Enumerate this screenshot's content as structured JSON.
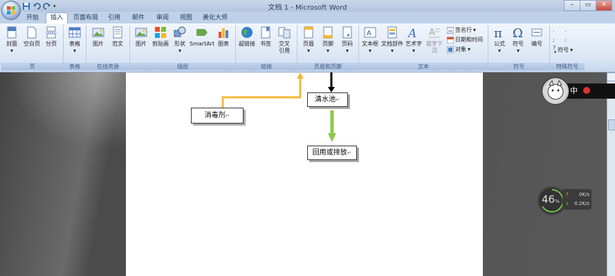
{
  "window": {
    "title": "文档 1 - Microsoft Word"
  },
  "quick_access": [
    "save-icon",
    "undo-icon",
    "redo-icon"
  ],
  "tabs": [
    {
      "label": "开始",
      "active": false
    },
    {
      "label": "插入",
      "active": true
    },
    {
      "label": "页面布局",
      "active": false
    },
    {
      "label": "引用",
      "active": false
    },
    {
      "label": "邮件",
      "active": false
    },
    {
      "label": "审阅",
      "active": false
    },
    {
      "label": "视图",
      "active": false
    },
    {
      "label": "美化大师",
      "active": false
    }
  ],
  "ribbon": {
    "groups": {
      "pages": "页",
      "tables": "表格",
      "online": "在线资源",
      "illustrations": "插图",
      "links": "链接",
      "header_footer": "页眉和页脚",
      "text": "文本",
      "symbols": "符号",
      "special": "特殊符号"
    },
    "pages": {
      "cover": "封面",
      "blank": "空白页",
      "break": "分页"
    },
    "tables": {
      "table": "表格"
    },
    "online": {
      "picture": "图片",
      "template": "范文"
    },
    "illustrations": {
      "picture": "图片",
      "clipart": "剪贴画",
      "shapes": "形状",
      "smartart": "SmartArt",
      "chart": "图表"
    },
    "links": {
      "hyperlink": "超链接",
      "bookmark": "书签",
      "crossref_1": "交叉",
      "crossref_2": "引用"
    },
    "header_footer": {
      "header": "页眉",
      "footer": "页脚",
      "page_number": "页码"
    },
    "text": {
      "textbox": "文本框",
      "quickparts": "文档部件",
      "wordart": "艺术字",
      "dropcap": "首字下沉",
      "signature": "签名行",
      "datetime": "日期和时间",
      "object": "对象"
    },
    "symbols": {
      "equation": "公式",
      "symbol": "符号",
      "numbering": "编号"
    },
    "special": {
      "symbol": "符号"
    }
  },
  "document": {
    "box_disinfectant": "消毒剂",
    "box_clear_water": "清水池",
    "box_reuse": "回用或排放",
    "para_mark": "↵",
    "arrow_colors": {
      "yellow": "#f5b833",
      "black": "#000000",
      "green": "#8cc84b"
    }
  },
  "ime": {
    "label": "中"
  },
  "network": {
    "percent": "46",
    "percent_sign": "%",
    "up": "0",
    "down": "0.2",
    "unit": "K/s"
  }
}
